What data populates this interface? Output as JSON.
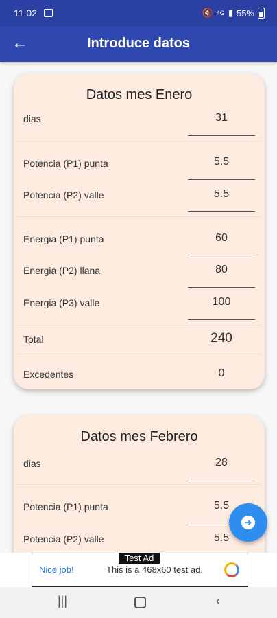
{
  "status": {
    "time": "11:02",
    "battery": "55%",
    "signal_text": "4G"
  },
  "appbar": {
    "title": "Introduce datos"
  },
  "cards": [
    {
      "title": "Datos mes Enero",
      "rows": [
        {
          "label": "dias",
          "value": "31"
        },
        {
          "label": "Potencia (P1) punta",
          "value": "5.5"
        },
        {
          "label": "Potencia (P2) valle",
          "value": "5.5"
        },
        {
          "label": "Energia (P1) punta",
          "value": "60"
        },
        {
          "label": "Energia (P2) llana",
          "value": "80"
        },
        {
          "label": "Energia (P3) valle",
          "value": "100"
        },
        {
          "label": "Total",
          "value": "240"
        },
        {
          "label": "Excedentes",
          "value": "0"
        }
      ]
    },
    {
      "title": "Datos mes Febrero",
      "rows": [
        {
          "label": "dias",
          "value": "28"
        },
        {
          "label": "Potencia (P1) punta",
          "value": "5.5"
        },
        {
          "label": "Potencia (P2) valle",
          "value": "5.5"
        }
      ]
    }
  ],
  "ad": {
    "tag": "Test Ad",
    "nice": "Nice job!",
    "text": "This is a 468x60 test ad."
  },
  "icons": {
    "back": "arrow-left-icon",
    "fab": "arrow-right-circle-icon",
    "nav": [
      "recent-apps-icon",
      "home-icon",
      "back-icon"
    ]
  }
}
